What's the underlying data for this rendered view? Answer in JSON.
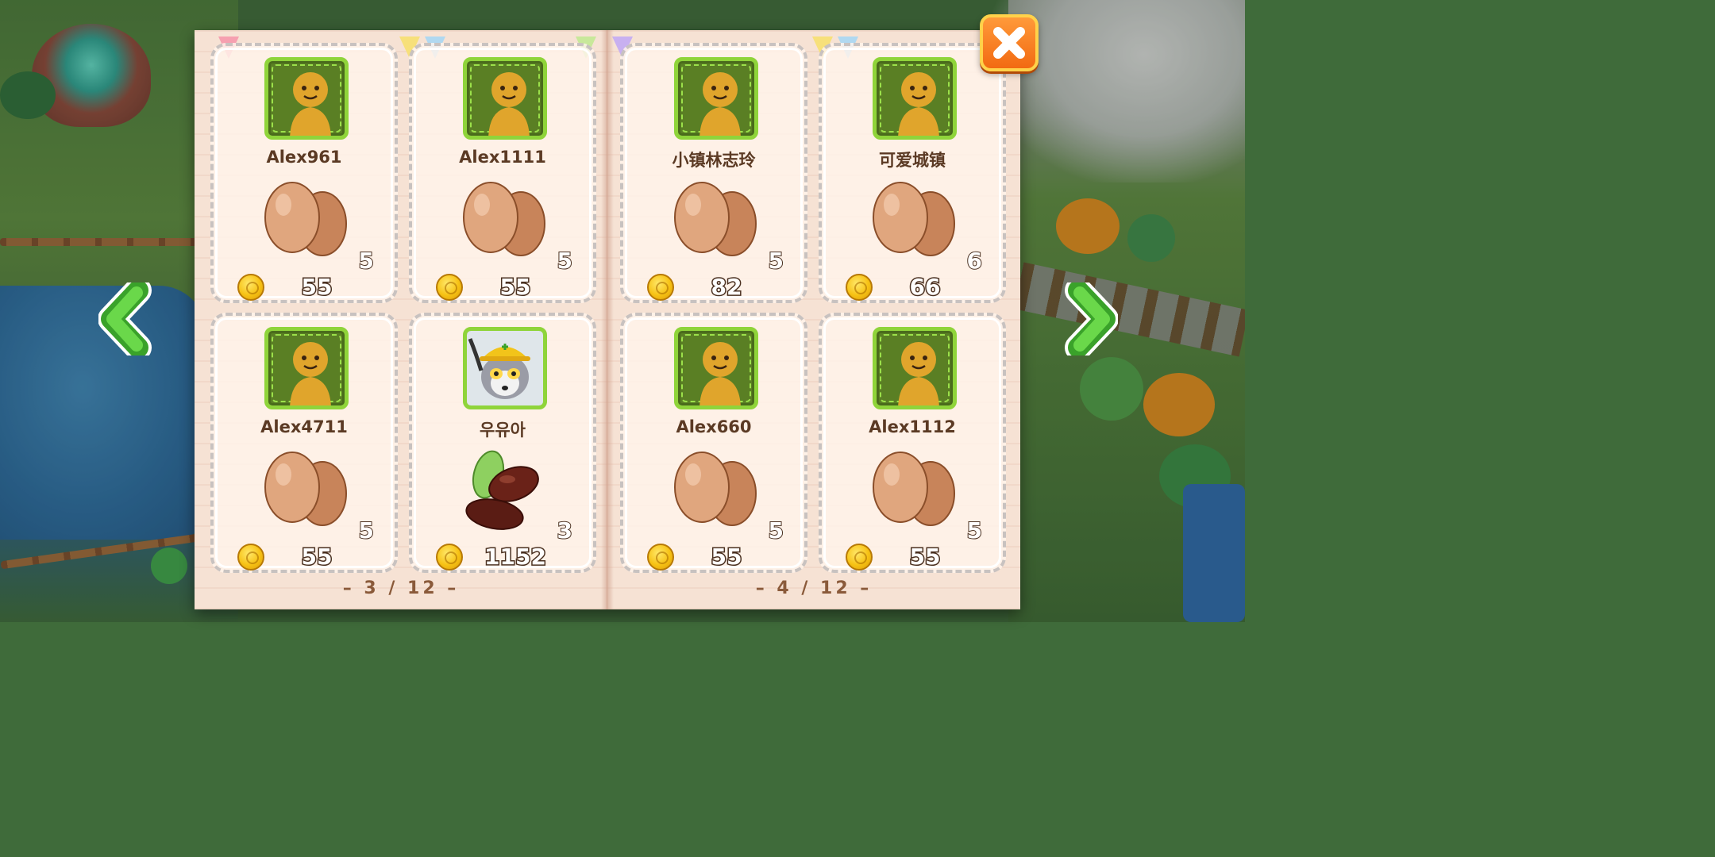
{
  "colors": {
    "avatar_bg": "#5a7f24",
    "avatar_border": "#8fd43a",
    "name_text": "#5b3a24",
    "coin": "#f7c214",
    "close_button": "#f26a12",
    "arrow_green": "#5cc43a"
  },
  "icons": {
    "close": "close-x-icon",
    "prev": "arrow-left-icon",
    "next": "arrow-right-icon",
    "coin": "coin-icon",
    "egg": "egg-icon",
    "raisins": "raisins-icon"
  },
  "pages": [
    {
      "indicator": "– 3 / 12 –",
      "offers": [
        {
          "player": "Alex961",
          "avatar": "gingerbread-avatar",
          "item": "egg",
          "quantity": "5",
          "price": "55"
        },
        {
          "player": "Alex1111",
          "avatar": "gingerbread-avatar",
          "item": "egg",
          "quantity": "5",
          "price": "55"
        },
        {
          "player": "Alex4711",
          "avatar": "gingerbread-avatar",
          "item": "egg",
          "quantity": "5",
          "price": "55"
        },
        {
          "player": "우유아",
          "avatar": "lemur-avatar",
          "item": "raisins",
          "quantity": "3",
          "price": "1152"
        }
      ]
    },
    {
      "indicator": "– 4 / 12 –",
      "offers": [
        {
          "player": "小镇林志玲",
          "avatar": "gingerbread-avatar",
          "item": "egg",
          "quantity": "5",
          "price": "82"
        },
        {
          "player": "可爱城镇",
          "avatar": "gingerbread-avatar",
          "item": "egg",
          "quantity": "6",
          "price": "66"
        },
        {
          "player": "Alex660",
          "avatar": "gingerbread-avatar",
          "item": "egg",
          "quantity": "5",
          "price": "55"
        },
        {
          "player": "Alex1112",
          "avatar": "gingerbread-avatar",
          "item": "egg",
          "quantity": "5",
          "price": "55"
        }
      ]
    }
  ]
}
